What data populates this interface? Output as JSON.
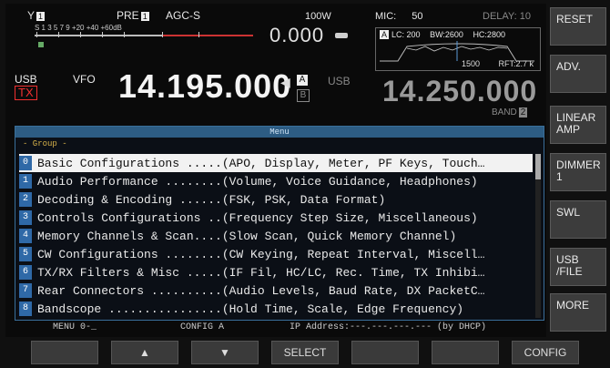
{
  "status": {
    "smeter_label": "Y",
    "antenna": "1",
    "pre_label": "PRE",
    "pre_value": "1",
    "agc": "AGC-S",
    "power": "100W",
    "rit": "0.000",
    "mic_label": "MIC:",
    "mic_value": "50",
    "delay": "DELAY: 10",
    "smeter_scale": "S  1   3   5   7   9   +20   +40 +60dB",
    "filter": {
      "tag": "A",
      "lc": "LC: 200",
      "bw": "BW:2600",
      "hc": "HC:2800",
      "center": "1500",
      "rft": "RFT:2.7 k"
    }
  },
  "vfo": {
    "mode": "USB",
    "tx": "TX",
    "label": "VFO",
    "freq_a": "14.195.000",
    "arrow": "◀",
    "tag_a": "A",
    "tag_b": "B",
    "mode_b": "USB",
    "freq_b": "14.250.000",
    "band_label": "BAND",
    "band_num": "2"
  },
  "menu": {
    "title": "Menu",
    "group": "- Group -",
    "items": [
      {
        "num": "0",
        "text": "Basic Configurations .....(APO, Display, Meter, PF Keys, Touch…"
      },
      {
        "num": "1",
        "text": "Audio Performance ........(Volume, Voice Guidance, Headphones)"
      },
      {
        "num": "2",
        "text": "Decoding & Encoding ......(FSK, PSK, Data Format)"
      },
      {
        "num": "3",
        "text": "Controls Configurations ..(Frequency Step Size, Miscellaneous)"
      },
      {
        "num": "4",
        "text": "Memory Channels & Scan....(Slow Scan, Quick Memory Channel)"
      },
      {
        "num": "5",
        "text": "CW Configurations ........(CW Keying, Repeat Interval, Miscell…"
      },
      {
        "num": "6",
        "text": "TX/RX Filters & Misc .....(IF Fil, HC/LC, Rec. Time, TX Inhibi…"
      },
      {
        "num": "7",
        "text": "Rear Connectors ..........(Audio Levels, Baud Rate, DX PacketC…"
      },
      {
        "num": "8",
        "text": "Bandscope ................(Hold Time, Scale, Edge Frequency)"
      }
    ],
    "footer": {
      "menu_no": "MENU 0-_",
      "config": "CONFIG A",
      "ip": "IP Address:---.---.---.--- (by DHCP)"
    }
  },
  "fkeys": {
    "k1": "",
    "k2": "▲",
    "k3": "▼",
    "k4": "SELECT",
    "k5": "",
    "k6": "",
    "k7": "CONFIG"
  },
  "side": {
    "reset": "RESET",
    "adv": "ADV.",
    "linear_amp": "LINEAR AMP",
    "dimmer": "DIMMER 1",
    "swl": "SWL",
    "usb_file": "USB /FILE",
    "more": "MORE"
  }
}
